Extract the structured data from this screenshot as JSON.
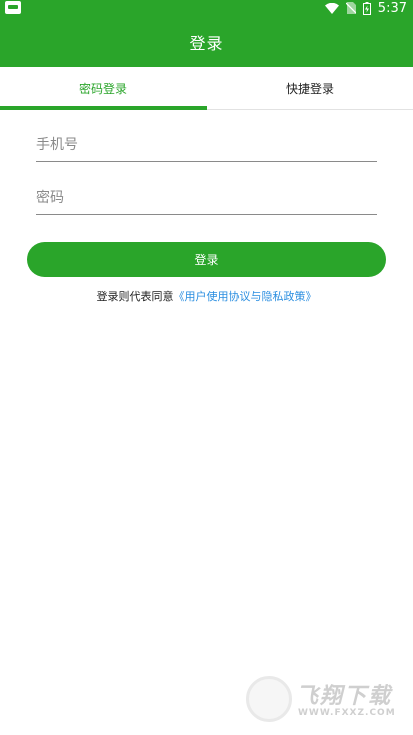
{
  "status_bar": {
    "time": "5:37",
    "icons": [
      "wifi-icon",
      "no-sim-icon",
      "battery-icon"
    ]
  },
  "app_bar": {
    "title": "登录"
  },
  "tabs": [
    {
      "label": "密码登录",
      "selected": true
    },
    {
      "label": "快捷登录",
      "selected": false
    }
  ],
  "form": {
    "phone": {
      "placeholder": "手机号",
      "value": ""
    },
    "password": {
      "placeholder": "密码",
      "value": ""
    },
    "submit_label": "登录"
  },
  "agreement": {
    "prefix": "登录则代表同意",
    "link": "《用户使用协议与隐私政策》"
  },
  "watermark": {
    "title": "飞翔下载",
    "url": "WWW.FXXZ.COM"
  },
  "colors": {
    "primary": "#2aa52a",
    "link": "#2a8ee0",
    "divider": "#e2e2e2"
  }
}
